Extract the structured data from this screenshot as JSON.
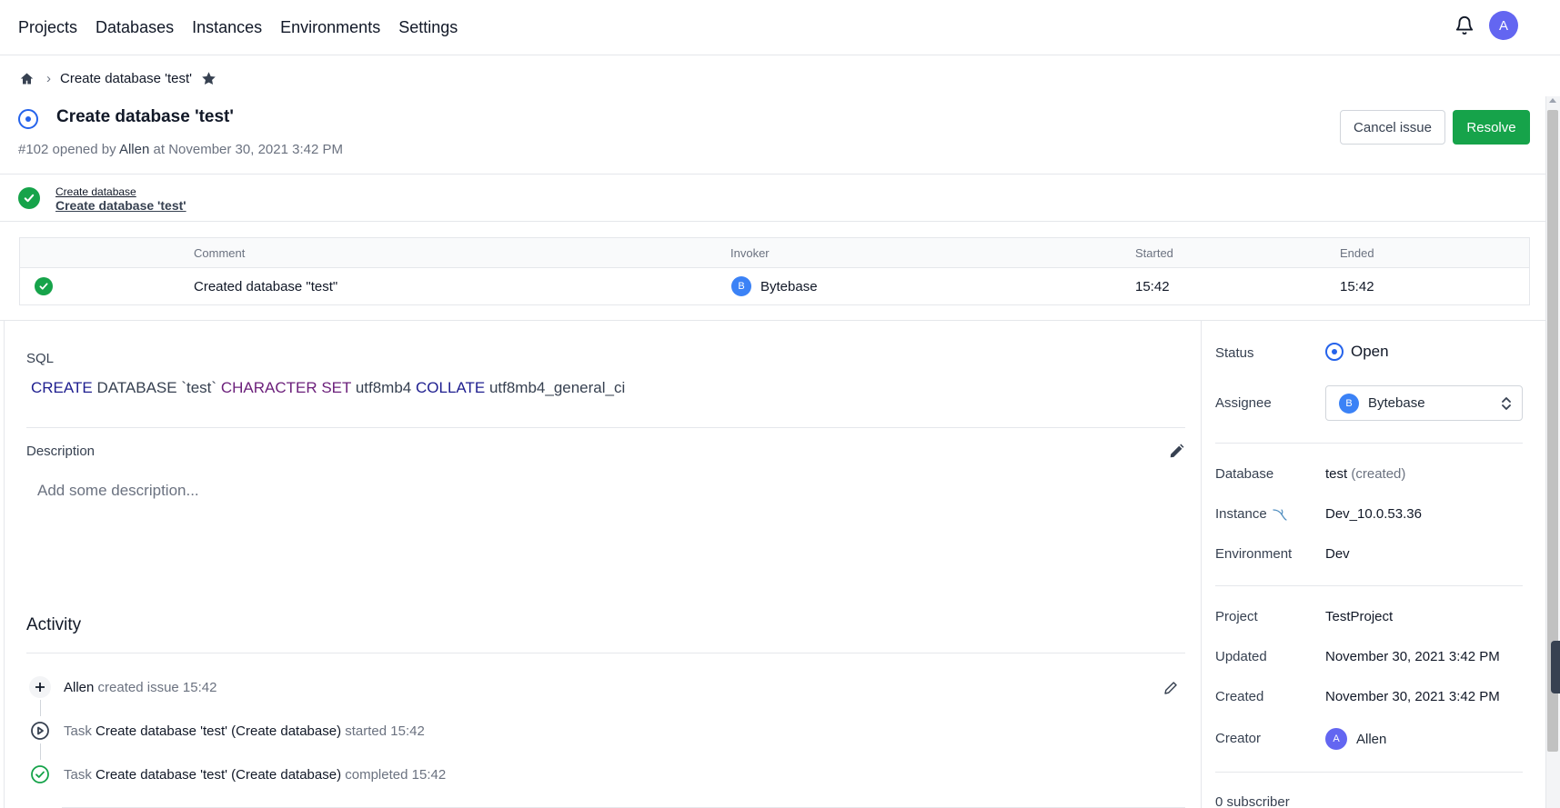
{
  "nav": {
    "items": [
      "Projects",
      "Databases",
      "Instances",
      "Environments",
      "Settings"
    ],
    "avatar_initial": "A"
  },
  "breadcrumb": {
    "current": "Create database 'test'"
  },
  "issue": {
    "title": "Create database 'test'",
    "number": "#102",
    "opened_by_text": "opened by",
    "author": "Allen",
    "at_text": "at",
    "opened_at": "November 30, 2021 3:42 PM",
    "cancel_label": "Cancel issue",
    "resolve_label": "Resolve"
  },
  "pipeline": {
    "stage_name": "Create database",
    "task_name": "Create database 'test'"
  },
  "task_runs": {
    "columns": [
      "Comment",
      "Invoker",
      "Started",
      "Ended"
    ],
    "rows": [
      {
        "comment": "Created database \"test\"",
        "invoker_initial": "B",
        "invoker": "Bytebase",
        "started": "15:42",
        "ended": "15:42"
      }
    ]
  },
  "sql": {
    "label": "SQL",
    "tokens": {
      "create": "CREATE",
      "database": "DATABASE",
      "name": "`test`",
      "character_set": "CHARACTER SET",
      "charset": "utf8mb4",
      "collate": "COLLATE",
      "collation": "utf8mb4_general_ci"
    }
  },
  "description": {
    "label": "Description",
    "placeholder": "Add some description..."
  },
  "activity": {
    "title": "Activity",
    "items": [
      {
        "actor": "Allen",
        "action": "created issue",
        "time": "15:42"
      },
      {
        "prefix": "Task",
        "task": "Create database 'test' (Create database)",
        "action": "started",
        "time": "15:42"
      },
      {
        "prefix": "Task",
        "task": "Create database 'test' (Create database)",
        "action": "completed",
        "time": "15:42"
      }
    ]
  },
  "sidebar": {
    "status_label": "Status",
    "status_value": "Open",
    "assignee_label": "Assignee",
    "assignee_initial": "B",
    "assignee_value": "Bytebase",
    "database_label": "Database",
    "database_value": "test",
    "database_note": "(created)",
    "instance_label": "Instance",
    "instance_value": "Dev_10.0.53.36",
    "environment_label": "Environment",
    "environment_value": "Dev",
    "project_label": "Project",
    "project_value": "TestProject",
    "updated_label": "Updated",
    "updated_value": "November 30, 2021 3:42 PM",
    "created_label": "Created",
    "created_value": "November 30, 2021 3:42 PM",
    "creator_label": "Creator",
    "creator_initial": "A",
    "creator_value": "Allen",
    "subscriber_text": "0 subscriber"
  },
  "colors": {
    "primary": "#2563eb",
    "success": "#16a34a",
    "avatar_indigo": "#6366f1",
    "avatar_blue": "#3b82f6"
  }
}
